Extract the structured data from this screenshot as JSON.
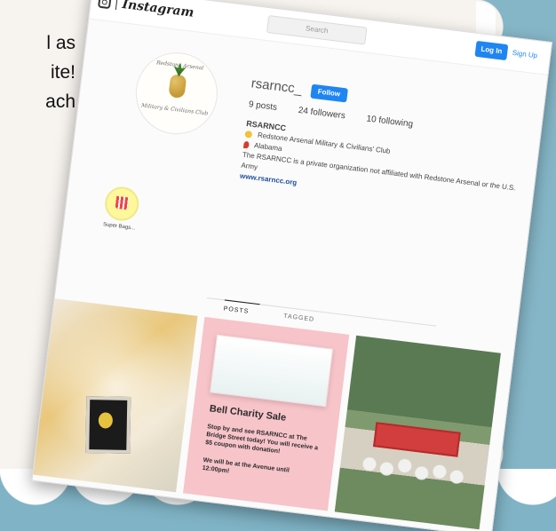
{
  "background_text": {
    "lines": [
      "l as",
      "ite!",
      "ach"
    ]
  },
  "header": {
    "brand": "Instagram",
    "search_placeholder": "Search",
    "login_label": "Log In",
    "signup_label": "Sign Up"
  },
  "profile": {
    "username": "rsarncc_",
    "follow_label": "Follow",
    "stats": {
      "posts": "9 posts",
      "followers": "24 followers",
      "following": "10 following"
    },
    "display_name": "RSARNCC",
    "bio_lines": [
      "Redstone Arsenal Military & Civilians' Club",
      "Alabama",
      "The RSARNCC is a private organization not affiliated with Redstone Arsenal or the U.S.",
      "Army"
    ],
    "website": "www.rsarncc.org",
    "profile_pic_text_top": "Redstone Arsenal",
    "profile_pic_text_bottom": "Military & Civilians Club"
  },
  "highlights": [
    {
      "label": "Super Bags..."
    }
  ],
  "tabs": {
    "posts": "POSTS",
    "tagged": "TAGGED"
  },
  "posts": {
    "post_2": {
      "title": "Bell Charity Sale",
      "line1": "Stop by and see RSARNCC at The Bridge Street today! You will receive a $5 coupon with donation!",
      "line2": "We will be at the Avenue until 12:00pm!"
    }
  },
  "colors": {
    "accent": "#1f85f2",
    "border_blue": "#7fb3c5",
    "pink_post": "#f7c4c9"
  }
}
